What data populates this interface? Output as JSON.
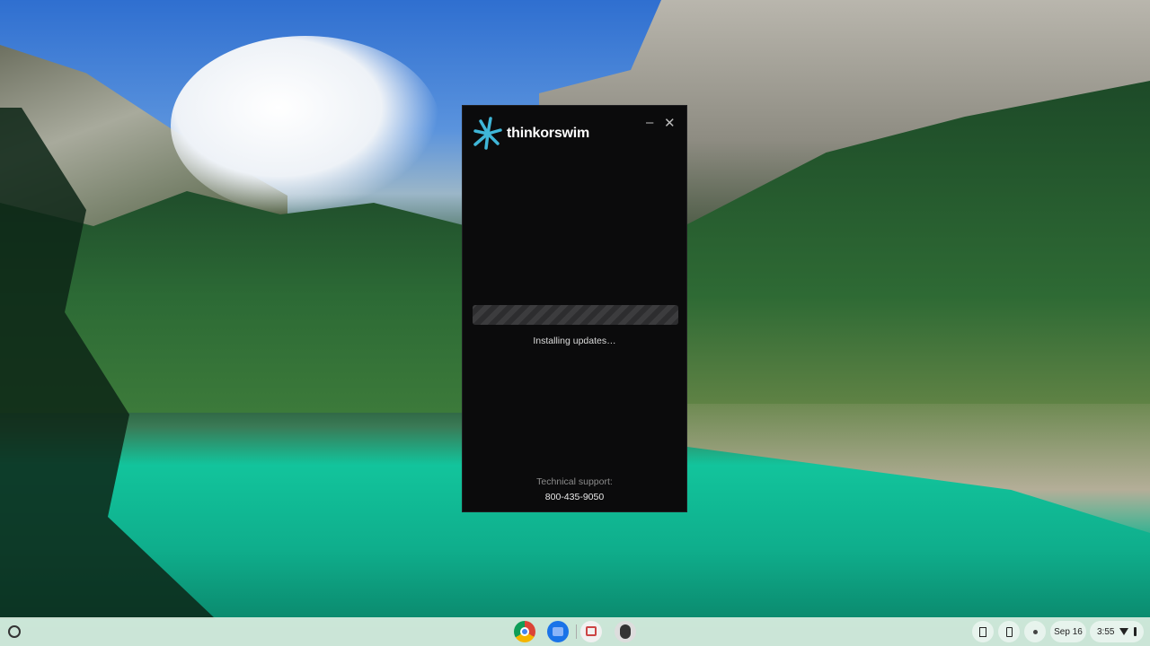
{
  "window": {
    "app_name": "thinkorswim",
    "minimize_label": "–",
    "close_label": "✕",
    "progress_mode": "indeterminate",
    "status_text": "Installing updates…",
    "support_label": "Technical support:",
    "support_phone": "800-435-9050",
    "brand_color": "#3fb6d8"
  },
  "shelf": {
    "apps": [
      "chrome-icon",
      "files-icon",
      "app-icon",
      "penguin-icon"
    ],
    "date": "Sep 16",
    "time": "3:55"
  }
}
